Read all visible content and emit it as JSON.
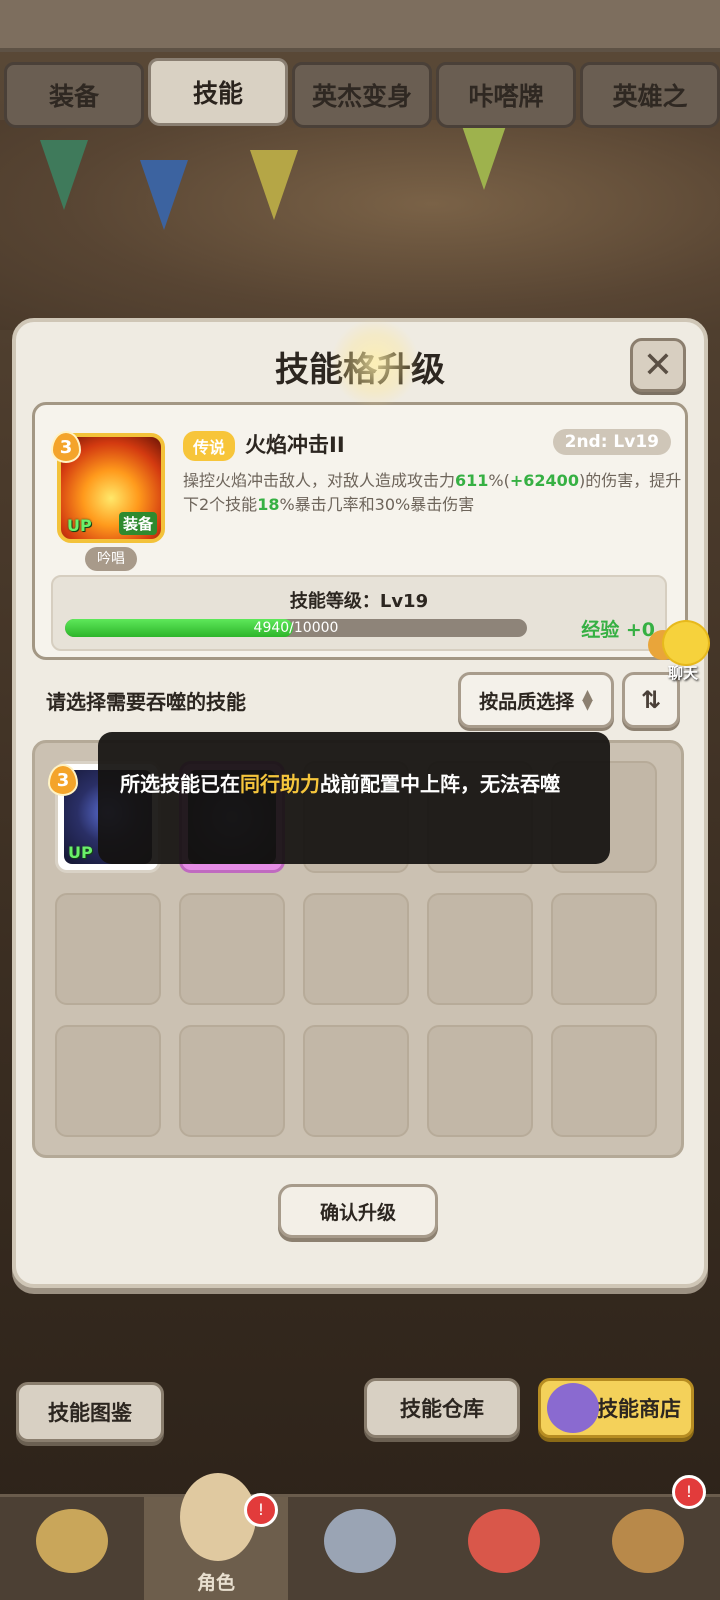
{
  "tabs": [
    {
      "label": "装备",
      "active": false
    },
    {
      "label": "技能",
      "active": true
    },
    {
      "label": "英杰变身",
      "active": false
    },
    {
      "label": "咔嗒牌",
      "active": false
    },
    {
      "label": "英雄之",
      "active": false
    }
  ],
  "dialog": {
    "title": "技能格升级",
    "close_icon": "close-icon",
    "skill": {
      "star": "3",
      "up_tag": "UP",
      "equip_tag": "装备",
      "chant_tag": "吟唱",
      "rarity": "传说",
      "name": "火焰冲击II",
      "level_badge": "2nd: Lv19",
      "desc_1": "操控火焰冲击敌人，对敌人造成攻击力",
      "desc_pct": "611",
      "desc_2": "%(",
      "desc_bonus": "+62400",
      "desc_3": ")的伤害，提升下2个技能",
      "desc_crit": "18",
      "desc_4": "%暴击几率和30%暴击伤害"
    },
    "exp": {
      "title": "技能等级：Lv19",
      "current": 4940,
      "max": 10000,
      "text": "4940/10000",
      "gain": "经验 +0"
    },
    "select_label": "请选择需要吞噬的技能",
    "quality_button": "按品质选择",
    "sort_icon": "sort-icon",
    "grid": {
      "slot1_star": "3",
      "slot1_up": "UP"
    },
    "confirm_button": "确认升级"
  },
  "toast": {
    "part1": "所选技能已在",
    "highlight": "同行助力",
    "part2": "战前配置中上阵，无法吞噬"
  },
  "chat": {
    "label": "聊天"
  },
  "bottom_buttons": {
    "codex": "技能图鉴",
    "storage": "技能仓库",
    "shop": "技能商店"
  },
  "nav": {
    "items": [
      {
        "label": ""
      },
      {
        "label": "角色"
      },
      {
        "label": ""
      },
      {
        "label": ""
      },
      {
        "label": ""
      }
    ],
    "badge": "!"
  },
  "colors": {
    "accent_green": "#36b043",
    "gold": "#f6c63c",
    "rarity_legend": "#f7c53a"
  }
}
